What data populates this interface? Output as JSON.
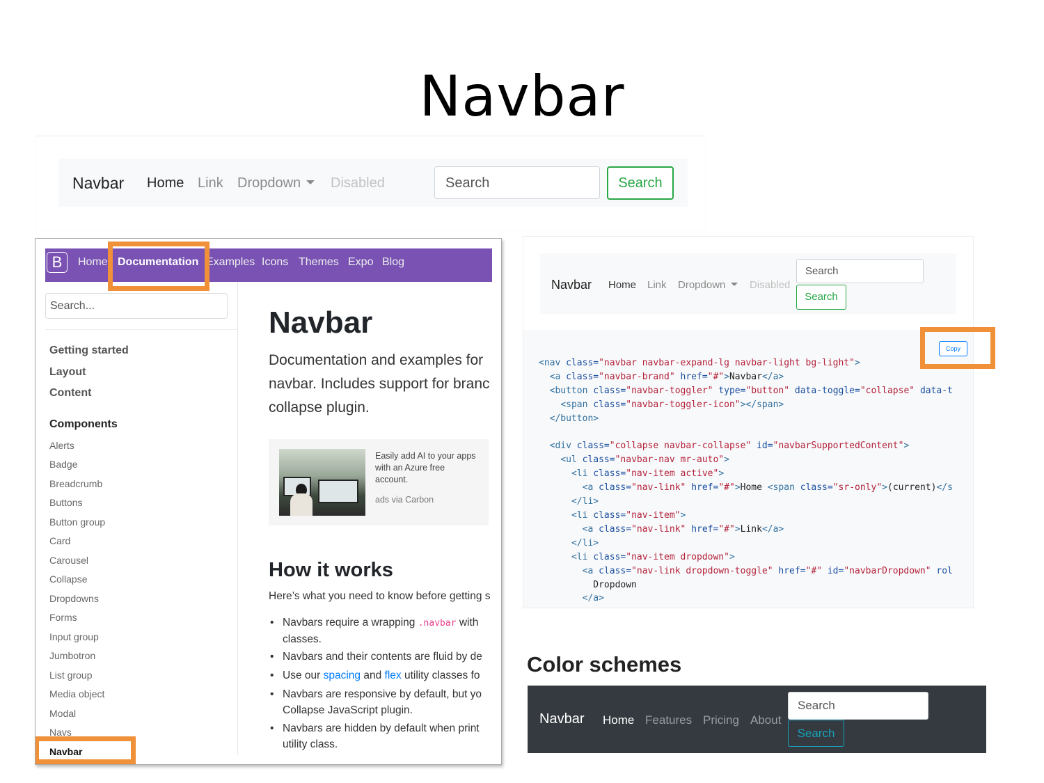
{
  "slide": {
    "title": "Navbar"
  },
  "demo_light": {
    "brand": "Navbar",
    "links": [
      "Home",
      "Link",
      "Dropdown",
      "Disabled"
    ],
    "search_placeholder": "Search",
    "search_button": "Search"
  },
  "docs": {
    "logo": "B",
    "nav": [
      "Home",
      "Documentation",
      "Examples",
      "Icons",
      "Themes",
      "Expo",
      "Blog"
    ],
    "search_placeholder": "Search...",
    "sidebar_top": [
      "Getting started",
      "Layout",
      "Content"
    ],
    "sidebar_heading": "Components",
    "sidebar_items": [
      "Alerts",
      "Badge",
      "Breadcrumb",
      "Buttons",
      "Button group",
      "Card",
      "Carousel",
      "Collapse",
      "Dropdowns",
      "Forms",
      "Input group",
      "Jumbotron",
      "List group",
      "Media object",
      "Modal",
      "Navs",
      "Navbar"
    ],
    "title": "Navbar",
    "lead": [
      "Documentation and examples for",
      "navbar. Includes support for branc",
      "collapse plugin."
    ],
    "ad_text": "Easily add AI to your apps with an Azure free account.",
    "ad_via": "ads via Carbon",
    "h2": "How it works",
    "intro": "Here’s what you need to know before getting s",
    "bullets": {
      "b1a": "Navbars require a wrapping ",
      "b1code": ".navbar",
      "b1b": " with",
      "b1c": "classes.",
      "b2": "Navbars and their contents are fluid by de",
      "b3a": "Use our ",
      "b3link1": "spacing",
      "b3b": " and ",
      "b3link2": "flex",
      "b3c": " utility classes fo",
      "b4a": "Navbars are responsive by default, but yo",
      "b4b": "Collapse JavaScript plugin.",
      "b5a": "Navbars are hidden by default when print",
      "b5b": "utility class."
    }
  },
  "demo_code": {
    "brand": "Navbar",
    "links": [
      "Home",
      "Link",
      "Dropdown",
      "Disabled"
    ],
    "search_placeholder": "Search",
    "search_button": "Search",
    "copy_button": "Copy"
  },
  "color_schemes": {
    "title": "Color schemes",
    "brand": "Navbar",
    "links": [
      "Home",
      "Features",
      "Pricing",
      "About"
    ],
    "search_placeholder": "Search",
    "search_button": "Search"
  },
  "colors": {
    "bootstrap_purple": "#7952b3",
    "highlight_orange": "#f0913a",
    "success_green": "#28a745",
    "dark_navbar": "#343a40",
    "info_teal": "#17a2b8"
  }
}
